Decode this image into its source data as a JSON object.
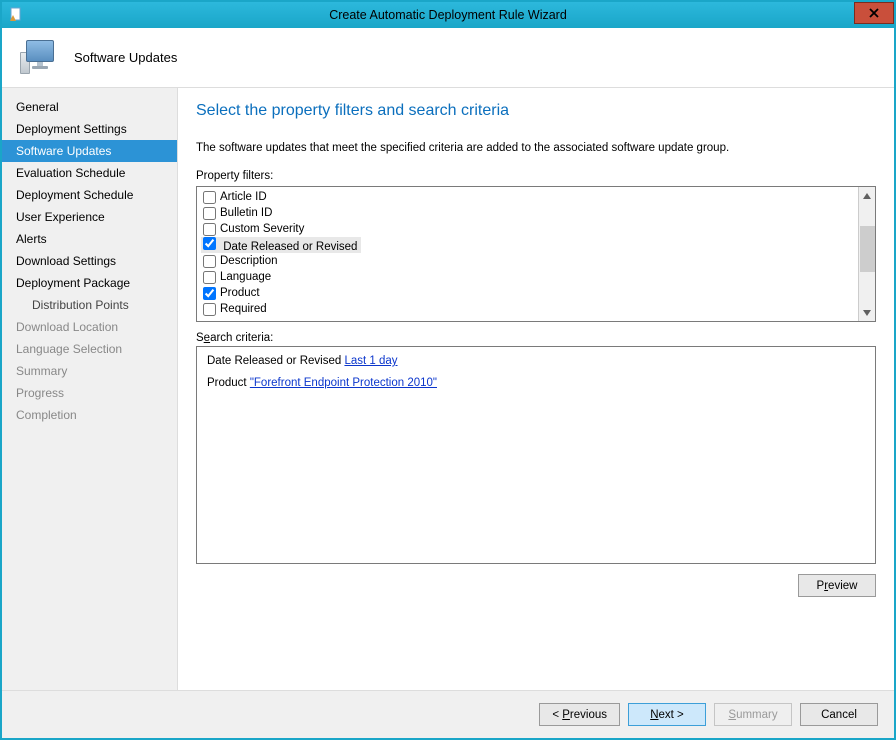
{
  "window": {
    "title": "Create Automatic Deployment Rule Wizard"
  },
  "header": {
    "label": "Software Updates"
  },
  "sidebar": {
    "items": [
      {
        "label": "General",
        "selected": false,
        "dim": false
      },
      {
        "label": "Deployment Settings",
        "selected": false,
        "dim": false
      },
      {
        "label": "Software Updates",
        "selected": true,
        "dim": false
      },
      {
        "label": "Evaluation Schedule",
        "selected": false,
        "dim": false
      },
      {
        "label": "Deployment Schedule",
        "selected": false,
        "dim": false
      },
      {
        "label": "User Experience",
        "selected": false,
        "dim": false
      },
      {
        "label": "Alerts",
        "selected": false,
        "dim": false
      },
      {
        "label": "Download Settings",
        "selected": false,
        "dim": false
      },
      {
        "label": "Deployment Package",
        "selected": false,
        "dim": false
      },
      {
        "label": "Distribution Points",
        "selected": false,
        "dim": false,
        "sub": true
      },
      {
        "label": "Download Location",
        "selected": false,
        "dim": true
      },
      {
        "label": "Language Selection",
        "selected": false,
        "dim": true
      },
      {
        "label": "Summary",
        "selected": false,
        "dim": true
      },
      {
        "label": "Progress",
        "selected": false,
        "dim": true
      },
      {
        "label": "Completion",
        "selected": false,
        "dim": true
      }
    ]
  },
  "main": {
    "heading": "Select the property filters and search criteria",
    "description": "The software updates that meet the specified criteria are added to the associated software update group.",
    "property_filters_label": "Property filters:",
    "filters": [
      {
        "label": "Article ID",
        "checked": false
      },
      {
        "label": "Bulletin ID",
        "checked": false
      },
      {
        "label": "Custom Severity",
        "checked": false
      },
      {
        "label": "Date Released or Revised",
        "checked": true,
        "highlight": true
      },
      {
        "label": "Description",
        "checked": false
      },
      {
        "label": "Language",
        "checked": false
      },
      {
        "label": "Product",
        "checked": true
      },
      {
        "label": "Required",
        "checked": false
      }
    ],
    "search_criteria_label": "Search criteria:",
    "criteria": {
      "line1_prefix": "Date Released or Revised ",
      "line1_link": "Last 1 day",
      "line2_prefix": "Product ",
      "line2_link": "\"Forefront Endpoint Protection 2010\""
    },
    "preview_btn": "Preview"
  },
  "footer": {
    "previous_pre": "< ",
    "previous_key": "P",
    "previous_post": "revious",
    "next_key": "N",
    "next_post": "ext >",
    "summary_key": "S",
    "summary_post": "ummary",
    "cancel": "Cancel"
  }
}
